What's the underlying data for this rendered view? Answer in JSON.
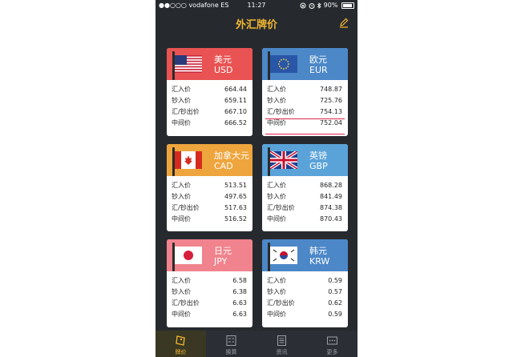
{
  "status": {
    "carrier": "●●○○○ vodafone ES",
    "time": "11:27",
    "battery": "90%"
  },
  "header": {
    "title": "外汇牌价"
  },
  "labels": {
    "buy": "汇入价",
    "cash_buy": "钞入价",
    "sell": "汇/钞出价",
    "mid": "中间价"
  },
  "cards": [
    {
      "name": "美元",
      "code": "USD",
      "color": "#e95353",
      "flag": "us-flag-icon",
      "buy": "664.44",
      "cash_buy": "659.11",
      "sell": "667.10",
      "mid": "666.52"
    },
    {
      "name": "欧元",
      "code": "EUR",
      "color": "#4c87c8",
      "flag": "eu-flag-icon",
      "buy": "748.87",
      "cash_buy": "725.76",
      "sell": "754.13",
      "mid": "752.04"
    },
    {
      "name": "加拿大元",
      "code": "CAD",
      "color": "#eea53d",
      "flag": "ca-flag-icon",
      "buy": "513.51",
      "cash_buy": "497.65",
      "sell": "517.63",
      "mid": "516.52"
    },
    {
      "name": "英镑",
      "code": "GBP",
      "color": "#5aa3d9",
      "flag": "gb-flag-icon",
      "buy": "868.28",
      "cash_buy": "841.49",
      "sell": "874.38",
      "mid": "870.43"
    },
    {
      "name": "日元",
      "code": "JPY",
      "color": "#f0838d",
      "flag": "jp-flag-icon",
      "buy": "6.58",
      "cash_buy": "6.38",
      "sell": "6.63",
      "mid": "6.63"
    },
    {
      "name": "韩元",
      "code": "KRW",
      "color": "#4c87c8",
      "flag": "kr-flag-icon",
      "buy": "0.59",
      "cash_buy": "0.57",
      "sell": "0.62",
      "mid": "0.59"
    }
  ],
  "tabs": [
    {
      "label": "牌价",
      "icon": "price-tag-icon",
      "active": true
    },
    {
      "label": "换算",
      "icon": "calculator-icon",
      "active": false
    },
    {
      "label": "资讯",
      "icon": "news-icon",
      "active": false
    },
    {
      "label": "更多",
      "icon": "more-icon",
      "active": false
    }
  ],
  "colors": {
    "accent": "#f2b730",
    "background": "#262a2f",
    "highlight_line": "#e0244f"
  }
}
